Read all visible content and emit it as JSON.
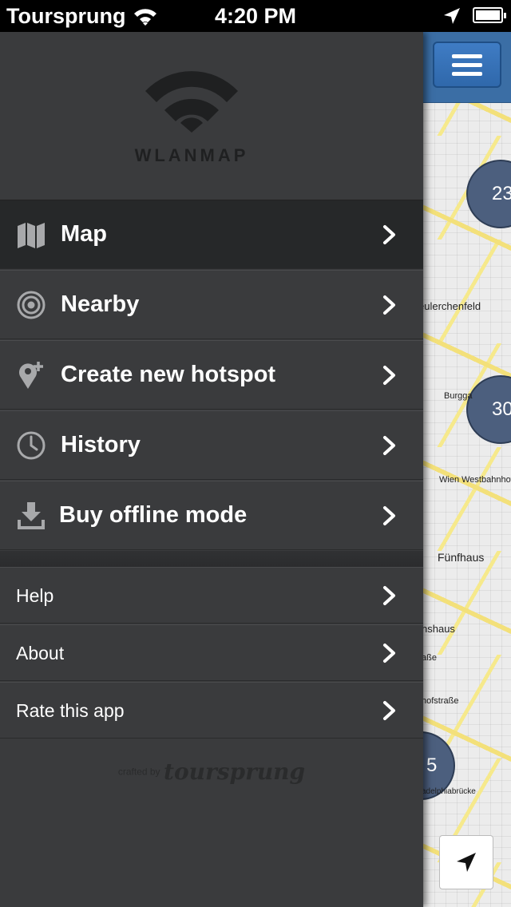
{
  "status_bar": {
    "carrier": "Toursprung",
    "time": "4:20 PM"
  },
  "menu": {
    "logo_text": "WLANMAP",
    "main_items": [
      {
        "label": "Map",
        "icon": "map-icon",
        "active": true
      },
      {
        "label": "Nearby",
        "icon": "target-icon",
        "active": false
      },
      {
        "label": "Create new hotspot",
        "icon": "add-pin-icon",
        "active": false
      },
      {
        "label": "History",
        "icon": "clock-icon",
        "active": false
      },
      {
        "label": "Buy offline mode",
        "icon": "download-icon",
        "active": false
      }
    ],
    "sub_items": [
      {
        "label": "Help"
      },
      {
        "label": "About"
      },
      {
        "label": "Rate this app"
      }
    ],
    "credit_prefix": "crafted by",
    "credit_brand": "toursprung"
  },
  "map": {
    "clusters": [
      "23",
      "30",
      "5"
    ],
    "labels": [
      "eulerchenfeld",
      "Burgga",
      "Wien Westbahnhof",
      "Fünfhaus",
      "nshaus",
      "aße",
      "hofstraße",
      "adelphiabrücke"
    ]
  },
  "colors": {
    "menu_bg": "#3a3b3d",
    "active_bg": "#262829",
    "nav_blue": "#3b6ea5",
    "cluster": "#4c5f7e"
  }
}
